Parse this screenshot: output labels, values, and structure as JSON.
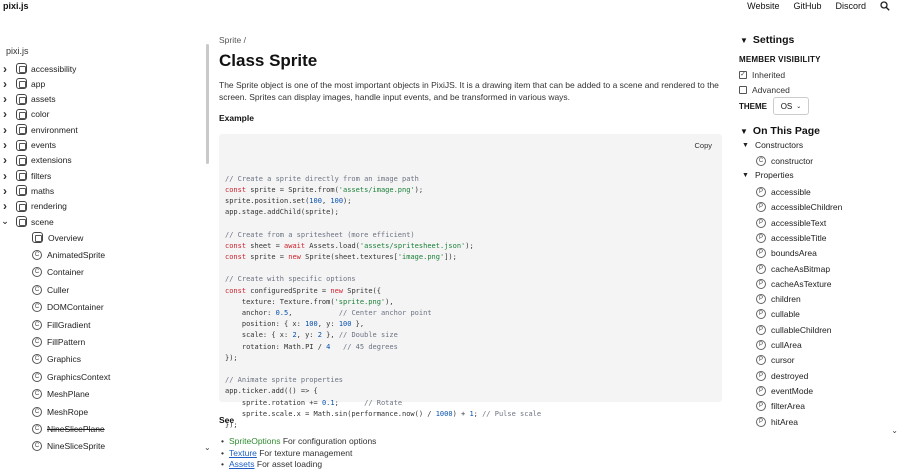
{
  "topbar": {
    "brand": "pixi.js",
    "links": [
      "Website",
      "GitHub",
      "Discord"
    ]
  },
  "sidebar": {
    "title": "pixi.js",
    "modules": [
      {
        "label": "accessibility",
        "expanded": false
      },
      {
        "label": "app",
        "expanded": false
      },
      {
        "label": "assets",
        "expanded": false
      },
      {
        "label": "color",
        "expanded": false
      },
      {
        "label": "environment",
        "expanded": false
      },
      {
        "label": "events",
        "expanded": false
      },
      {
        "label": "extensions",
        "expanded": false
      },
      {
        "label": "filters",
        "expanded": false
      },
      {
        "label": "maths",
        "expanded": false
      },
      {
        "label": "rendering",
        "expanded": false
      },
      {
        "label": "scene",
        "expanded": true
      }
    ],
    "scene_children": [
      {
        "label": "Overview",
        "kind": "module",
        "deprecated": false
      },
      {
        "label": "AnimatedSprite",
        "kind": "class",
        "deprecated": false
      },
      {
        "label": "Container",
        "kind": "class",
        "deprecated": false
      },
      {
        "label": "Culler",
        "kind": "class",
        "deprecated": false
      },
      {
        "label": "DOMContainer",
        "kind": "class",
        "deprecated": false
      },
      {
        "label": "FillGradient",
        "kind": "class",
        "deprecated": false
      },
      {
        "label": "FillPattern",
        "kind": "class",
        "deprecated": false
      },
      {
        "label": "Graphics",
        "kind": "class",
        "deprecated": false
      },
      {
        "label": "GraphicsContext",
        "kind": "class",
        "deprecated": false
      },
      {
        "label": "MeshPlane",
        "kind": "class",
        "deprecated": false
      },
      {
        "label": "MeshRope",
        "kind": "class",
        "deprecated": false
      },
      {
        "label": "NineSlicePlane",
        "kind": "class",
        "deprecated": true
      },
      {
        "label": "NineSliceSprite",
        "kind": "class",
        "deprecated": false
      }
    ]
  },
  "main": {
    "breadcrumb": "Sprite /",
    "title": "Class Sprite",
    "intro": "The Sprite object is one of the most important objects in PixiJS. It is a drawing item that can be added to a scene and rendered to the screen. Sprites can display images, handle input events, and be transformed in various ways.",
    "example_heading": "Example",
    "copy_label": "Copy",
    "code": "// Create a sprite directly from an image path\nconst sprite = Sprite.from('assets/image.png');\nsprite.position.set(100, 100);\napp.stage.addChild(sprite);\n\n// Create from a spritesheet (more efficient)\nconst sheet = await Assets.load('assets/spritesheet.json');\nconst sprite = new Sprite(sheet.textures['image.png']);\n\n// Create with specific options\nconst configuredSprite = new Sprite({\n    texture: Texture.from('sprite.png'),\n    anchor: 0.5,           // Center anchor point\n    position: { x: 100, y: 100 },\n    scale: { x: 2, y: 2 }, // Double size\n    rotation: Math.PI / 4   // 45 degrees\n});\n\n// Animate sprite properties\napp.ticker.add(() => {\n    sprite.rotation += 0.1;      // Rotate\n    sprite.scale.x = Math.sin(performance.now() / 1000) + 1; // Pulse scale\n});",
    "see_heading": "See",
    "see_items": [
      {
        "link": "SpriteOptions",
        "text": " For configuration options",
        "style": "green"
      },
      {
        "link": "Texture",
        "text": " For texture management",
        "style": "blue"
      },
      {
        "link": "Assets",
        "text": " For asset loading",
        "style": "blue"
      }
    ]
  },
  "settings": {
    "heading": "Settings",
    "member_visibility_label": "MEMBER VISIBILITY",
    "inherited_label": "Inherited",
    "inherited_checked": true,
    "advanced_label": "Advanced",
    "advanced_checked": false,
    "theme_label": "THEME",
    "theme_value": "OS"
  },
  "toc": {
    "heading": "On This Page",
    "constructors_label": "Constructors",
    "constructors": [
      "constructor"
    ],
    "properties_label": "Properties",
    "properties": [
      "accessible",
      "accessibleChildren",
      "accessibleText",
      "accessibleTitle",
      "boundsArea",
      "cacheAsBitmap",
      "cacheAsTexture",
      "children",
      "cullable",
      "cullableChildren",
      "cullArea",
      "cursor",
      "destroyed",
      "eventMode",
      "filterArea",
      "hitArea"
    ]
  }
}
